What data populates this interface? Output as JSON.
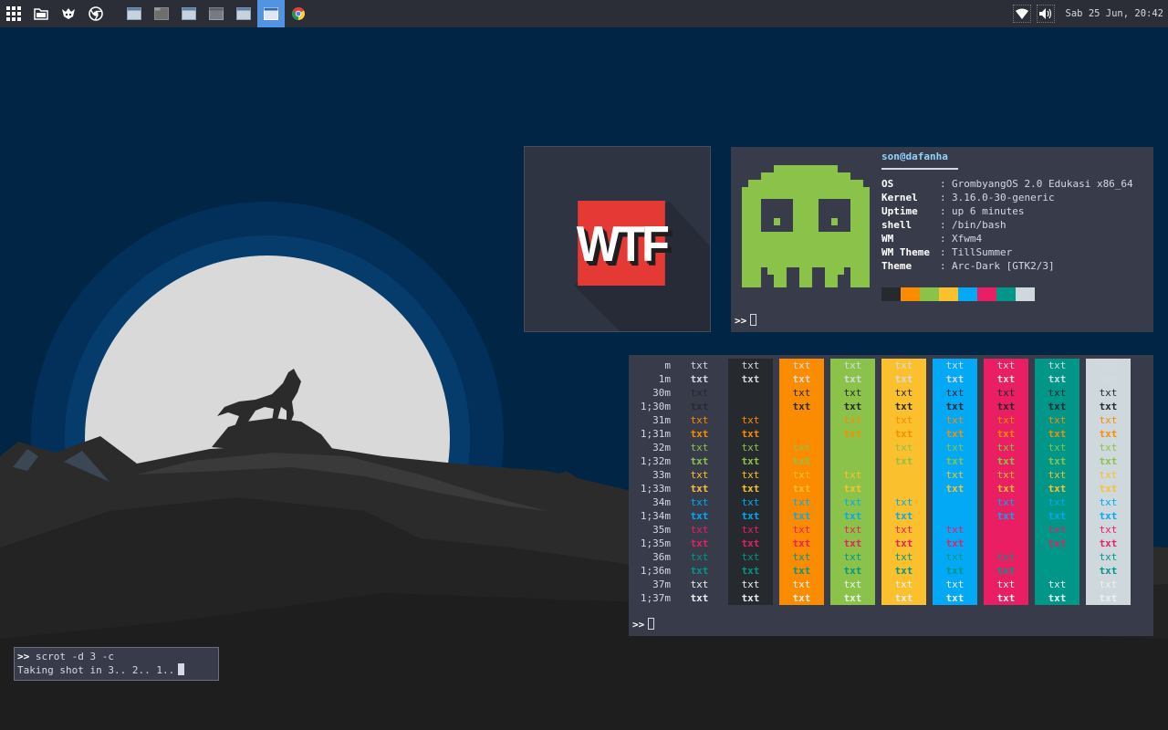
{
  "panel": {
    "launchers": [
      {
        "name": "apps-grid-icon"
      },
      {
        "name": "file-manager-icon"
      },
      {
        "name": "app-logo-icon"
      },
      {
        "name": "chrome-icon"
      }
    ],
    "tasks": [
      {
        "name": "window-task-1",
        "active": false
      },
      {
        "name": "window-task-2",
        "active": false
      },
      {
        "name": "window-task-3",
        "active": false
      },
      {
        "name": "window-task-4",
        "active": false
      },
      {
        "name": "window-task-5",
        "active": false
      },
      {
        "name": "window-task-6",
        "active": true
      },
      {
        "name": "chrome-task",
        "active": false
      }
    ],
    "clock": "Sab 25 Jun, 20:42"
  },
  "wtf": {
    "logo_text": "WTF"
  },
  "neofetch": {
    "userhost": "son@dafanha",
    "info": [
      {
        "key": "OS",
        "value": "GrombyangOS 2.0 Edukasi x86_64"
      },
      {
        "key": "Kernel",
        "value": "3.16.0-30-generic"
      },
      {
        "key": "Uptime",
        "value": "up 6 minutes"
      },
      {
        "key": "shell",
        "value": "/bin/bash"
      },
      {
        "key": "WM",
        "value": "Xfwm4"
      },
      {
        "key": "WM Theme",
        "value": "TillSummer"
      },
      {
        "key": "Theme",
        "value": "Arc-Dark [GTK2/3]"
      }
    ],
    "separator": ":",
    "swatches": [
      "#262a2e",
      "#fb8c00",
      "#8bc34a",
      "#fbc02d",
      "#03a9f4",
      "#e91e63",
      "#009688",
      "#cfd8dc"
    ],
    "prompt": ">>"
  },
  "colortable": {
    "labels": [
      "m",
      "1m",
      "30m",
      "1;30m",
      "31m",
      "1;31m",
      "32m",
      "1;32m",
      "33m",
      "1;33m",
      "34m",
      "1;34m",
      "35m",
      "1;35m",
      "36m",
      "1;36m",
      "37m",
      "1;37m"
    ],
    "cell_text": "txt",
    "backgrounds": [
      "",
      "#262a2e",
      "#fb8c00",
      "#8bc34a",
      "#fbc02d",
      "#03a9f4",
      "#e91e63",
      "#009688",
      "#cfd8dc"
    ],
    "fg_default": "#d3dae3",
    "fg_colors": {
      "30": "#262a2e",
      "31": "#fb8c00",
      "32": "#8bc34a",
      "33": "#fbc02d",
      "34": "#03a9f4",
      "35": "#e91e63",
      "36": "#009688",
      "37": "#eceff1"
    },
    "prompt": ">>"
  },
  "scrot": {
    "prompt": ">>",
    "command": "scrot -d 3 -c",
    "output": "Taking shot in 3.. 2.. 1.."
  }
}
